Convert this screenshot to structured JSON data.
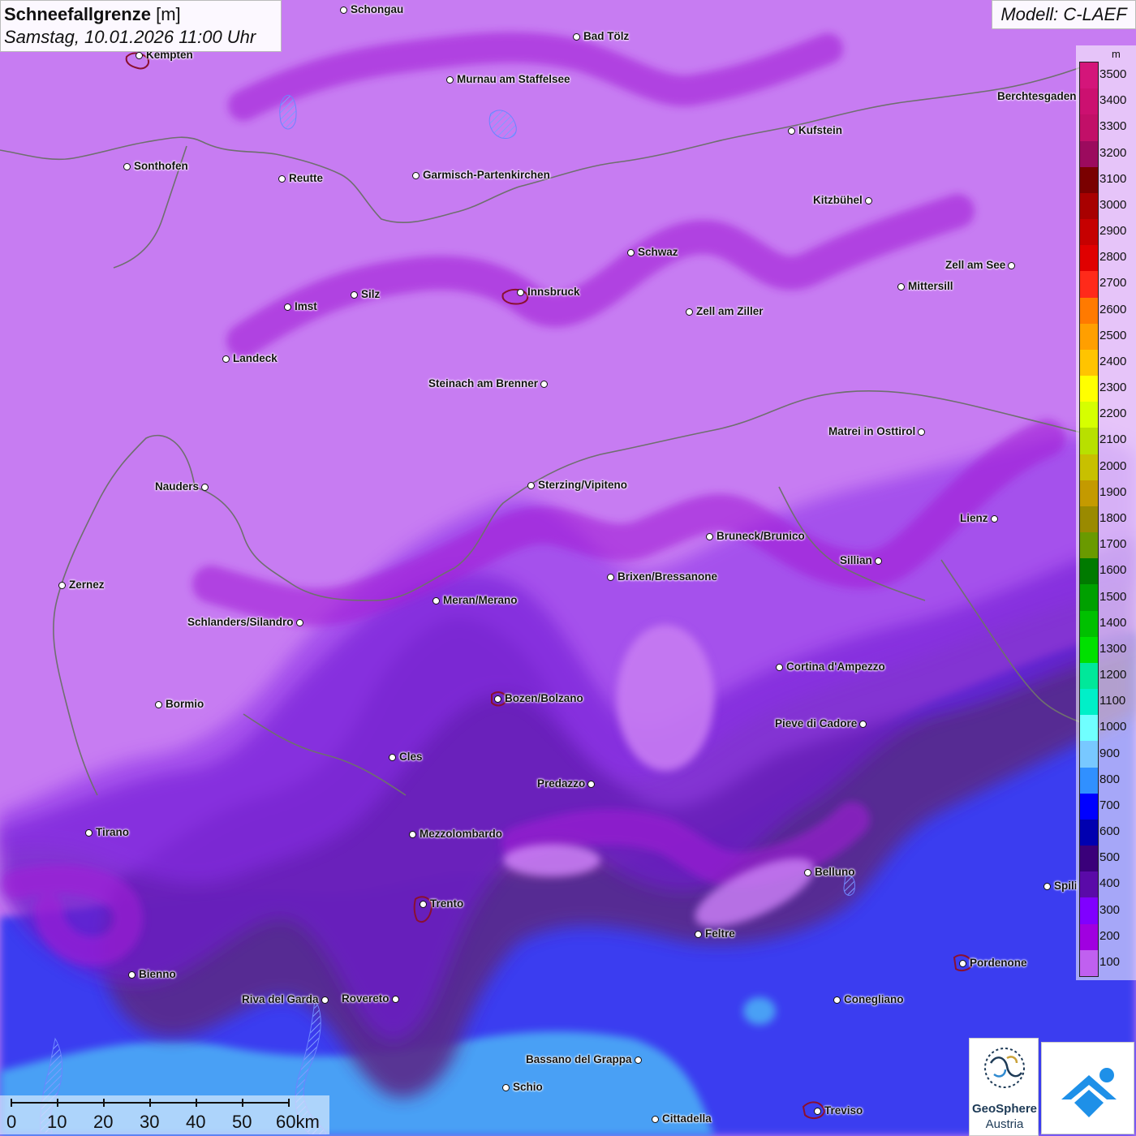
{
  "header": {
    "title": "Schneefallgrenze",
    "unit_suffix": "[m]",
    "datetime": "Samstag, 10.01.2026 11:00 Uhr"
  },
  "model": "Modell: C-LAEF",
  "legend": {
    "unit": "m",
    "levels": [
      {
        "label": "3500",
        "color": "#d4157a"
      },
      {
        "label": "3400",
        "color": "#cc1070"
      },
      {
        "label": "3300",
        "color": "#c20f68"
      },
      {
        "label": "3200",
        "color": "#9c0a5e"
      },
      {
        "label": "3100",
        "color": "#7a0000"
      },
      {
        "label": "3000",
        "color": "#a80000"
      },
      {
        "label": "2900",
        "color": "#c60000"
      },
      {
        "label": "2800",
        "color": "#e00000"
      },
      {
        "label": "2700",
        "color": "#ff2a1a"
      },
      {
        "label": "2600",
        "color": "#ff7a00"
      },
      {
        "label": "2500",
        "color": "#ff9f00"
      },
      {
        "label": "2400",
        "color": "#ffc400"
      },
      {
        "label": "2300",
        "color": "#ffff00"
      },
      {
        "label": "2200",
        "color": "#d6ff00"
      },
      {
        "label": "2100",
        "color": "#b8e000"
      },
      {
        "label": "2000",
        "color": "#c8c000"
      },
      {
        "label": "1900",
        "color": "#c49a00"
      },
      {
        "label": "1800",
        "color": "#9a8a00"
      },
      {
        "label": "1700",
        "color": "#6a9a00"
      },
      {
        "label": "1600",
        "color": "#007a00"
      },
      {
        "label": "1500",
        "color": "#00a000"
      },
      {
        "label": "1400",
        "color": "#00c000"
      },
      {
        "label": "1300",
        "color": "#00e000"
      },
      {
        "label": "1200",
        "color": "#00e89a"
      },
      {
        "label": "1100",
        "color": "#00f0c8"
      },
      {
        "label": "1000",
        "color": "#70ffff"
      },
      {
        "label": "900",
        "color": "#78c8ff"
      },
      {
        "label": "800",
        "color": "#3090ff"
      },
      {
        "label": "700",
        "color": "#0000ff"
      },
      {
        "label": "600",
        "color": "#0000b0"
      },
      {
        "label": "500",
        "color": "#3a007a"
      },
      {
        "label": "400",
        "color": "#5a0aa8"
      },
      {
        "label": "300",
        "color": "#8000ff"
      },
      {
        "label": "200",
        "color": "#a000e0"
      },
      {
        "label": "100",
        "color": "#c060f0"
      }
    ]
  },
  "cities": [
    {
      "name": "Schongau",
      "side": "right"
    },
    {
      "name": "Kempten",
      "side": "right"
    },
    {
      "name": "Bad Tölz",
      "side": "right"
    },
    {
      "name": "Murnau am Staffelsee",
      "side": "right"
    },
    {
      "name": "Berchtesgaden",
      "side": "left"
    },
    {
      "name": "Kufstein",
      "side": "right"
    },
    {
      "name": "Sonthofen",
      "side": "right"
    },
    {
      "name": "Reutte",
      "side": "right"
    },
    {
      "name": "Garmisch-Partenkirchen",
      "side": "right"
    },
    {
      "name": "Kitzbühel",
      "side": "left"
    },
    {
      "name": "Schwaz",
      "side": "right"
    },
    {
      "name": "Zell am See",
      "side": "left"
    },
    {
      "name": "Mittersill",
      "side": "right"
    },
    {
      "name": "Innsbruck",
      "side": "right"
    },
    {
      "name": "Silz",
      "side": "right"
    },
    {
      "name": "Imst",
      "side": "right"
    },
    {
      "name": "Zell am Ziller",
      "side": "right"
    },
    {
      "name": "Landeck",
      "side": "right"
    },
    {
      "name": "Steinach am Brenner",
      "side": "left"
    },
    {
      "name": "Matrei in Osttirol",
      "side": "left"
    },
    {
      "name": "Nauders",
      "side": "left"
    },
    {
      "name": "Sterzing/Vipiteno",
      "side": "right"
    },
    {
      "name": "Lienz",
      "side": "left"
    },
    {
      "name": "Bruneck/Brunico",
      "side": "right"
    },
    {
      "name": "Sillian",
      "side": "left"
    },
    {
      "name": "Brixen/Bressanone",
      "side": "right"
    },
    {
      "name": "Zernez",
      "side": "right"
    },
    {
      "name": "Meran/Merano",
      "side": "right"
    },
    {
      "name": "Schlanders/Silandro",
      "side": "left"
    },
    {
      "name": "Cortina d'Ampezzo",
      "side": "right"
    },
    {
      "name": "Bozen/Bolzano",
      "side": "right"
    },
    {
      "name": "Bormio",
      "side": "right"
    },
    {
      "name": "Pieve di Cadore",
      "side": "left"
    },
    {
      "name": "Cles",
      "side": "right"
    },
    {
      "name": "Predazzo",
      "side": "left"
    },
    {
      "name": "Tirano",
      "side": "right"
    },
    {
      "name": "Mezzolombardo",
      "side": "right"
    },
    {
      "name": "Belluno",
      "side": "right"
    },
    {
      "name": "Spili",
      "side": "right"
    },
    {
      "name": "Trento",
      "side": "right"
    },
    {
      "name": "Feltre",
      "side": "right"
    },
    {
      "name": "Pordenone",
      "side": "right"
    },
    {
      "name": "Bienno",
      "side": "right"
    },
    {
      "name": "Riva del Garda",
      "side": "left"
    },
    {
      "name": "Rovereto",
      "side": "left"
    },
    {
      "name": "Conegliano",
      "side": "right"
    },
    {
      "name": "Bassano del Grappa",
      "side": "left"
    },
    {
      "name": "Schio",
      "side": "right"
    },
    {
      "name": "Treviso",
      "side": "right"
    },
    {
      "name": "Cittadella",
      "side": "right"
    }
  ],
  "scale_bar": {
    "labels": [
      "0",
      "10",
      "20",
      "30",
      "40",
      "50",
      "60km"
    ]
  },
  "logos": {
    "geosphere_line1": "GeoSphere",
    "geosphere_line2": "Austria"
  }
}
